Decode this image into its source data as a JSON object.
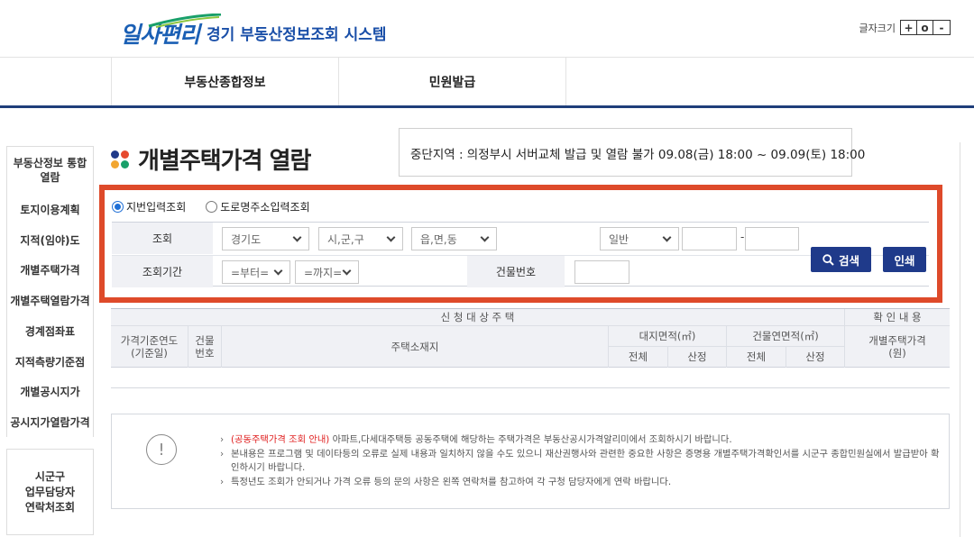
{
  "header": {
    "logo_text": "일사편리",
    "logo_subtitle": "경기 부동산정보조회 시스템",
    "font_size_label": "글자크기",
    "font_size_buttons": [
      "+",
      "o",
      "-"
    ]
  },
  "nav": {
    "items": [
      "부동산종합정보",
      "민원발급"
    ]
  },
  "sidebar": {
    "items": [
      "부동산정보 통합\n열람",
      "토지이용계획",
      "지적(임야)도",
      "개별주택가격",
      "개별주택열람가격",
      "경계점좌표",
      "지적측량기준점",
      "개별공시지가",
      "공시지가열람가격"
    ],
    "contact": "시군구\n업무담당자\n연락처조회"
  },
  "page": {
    "title": "개별주택가격 열람",
    "notice": "중단지역 : 의정부시 서버교체 발급 및 열람 불가 09.08(금) 18:00 ~ 09.09(토) 18:00"
  },
  "search": {
    "radio_options": [
      {
        "label": "지번입력조회",
        "selected": true
      },
      {
        "label": "도로명주소입력조회",
        "selected": false
      }
    ],
    "row1_label": "조회",
    "selects_row1": [
      "경기도",
      "시,군,구",
      "읍,면,동",
      "일반"
    ],
    "separator": "-",
    "row2_label": "조회기간",
    "period_from": "=부터=",
    "period_to": "=까지=",
    "building_no_label": "건물번호",
    "search_button": "검색",
    "print_button": "인쇄"
  },
  "results": {
    "group_left": "신 청 대 상 주 택",
    "group_right": "확 인 내 용",
    "col_year": "가격기준연도\n(기준일)",
    "col_building": "건물\n번호",
    "col_address": "주택소재지",
    "col_land_area": "대지면적(㎡)",
    "col_building_area": "건물연면적(㎡)",
    "col_price": "개별주택가격\n(원)",
    "sub_total": "전체",
    "sub_calc": "산정"
  },
  "info": {
    "icon": "exclamation-icon",
    "line1_prefix": "(공동주택가격 조회 안내)",
    "line1_rest": " 아파트,다세대주택등 공동주택에 해당하는 주택가격은 부동산공시가격알리미에서 조회하시기 바랍니다.",
    "line2": "본내용은 프로그램 및 데이타등의 오류로 실제 내용과 일치하지 않을 수도 있으니 재산권행사와 관련한 중요한 사항은 증명용 개별주택가격확인서를 시군구 종합민원실에서 발급받아 확인하시기 바랍니다.",
    "line3": "특정년도 조회가 안되거나 가격 오류 등의 문의 사항은 왼쪽 연락처를 참고하여 각 구청 담당자에게 연락 바랍니다."
  },
  "colors": {
    "brand_blue": "#1f3a8a",
    "highlight_frame": "#de4a2a",
    "nav_underline": "#1f3e7a",
    "title_dot_colors": [
      "#1f3a8a",
      "#e64a2e",
      "#f2a630",
      "#19a06a"
    ]
  }
}
